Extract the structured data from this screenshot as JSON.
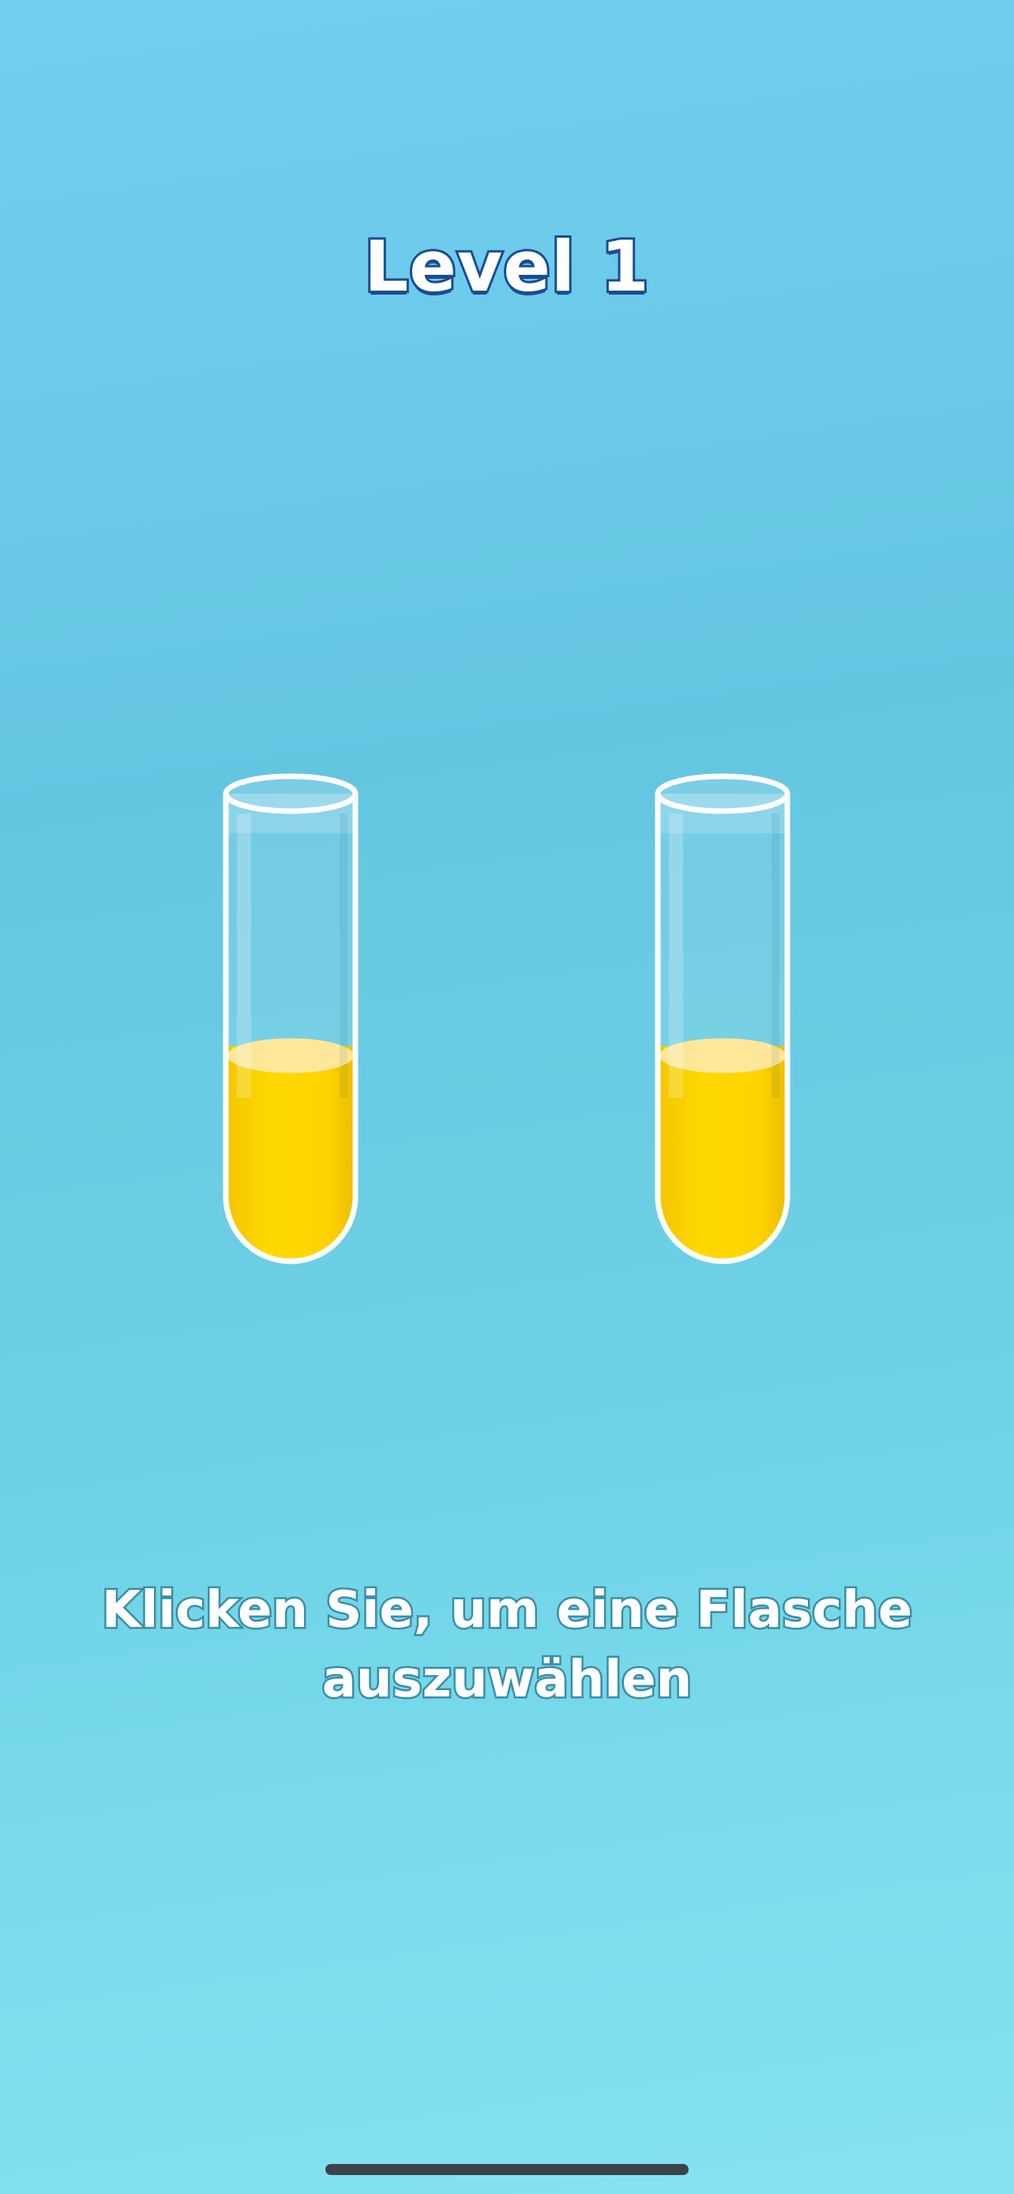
{
  "header": {
    "level_title": "Level 1"
  },
  "bottles": [
    {
      "id": "bottle-1",
      "fill_fraction": 0.46,
      "liquid_color": "#ffd400"
    },
    {
      "id": "bottle-2",
      "fill_fraction": 0.46,
      "liquid_color": "#ffd400"
    }
  ],
  "instruction": {
    "text": "Klicken Sie, um eine Flasche auszuwählen"
  },
  "colors": {
    "title_outline": "#1b4b94",
    "instruction_outline": "#3a8ea8",
    "liquid": "#ffd400"
  }
}
